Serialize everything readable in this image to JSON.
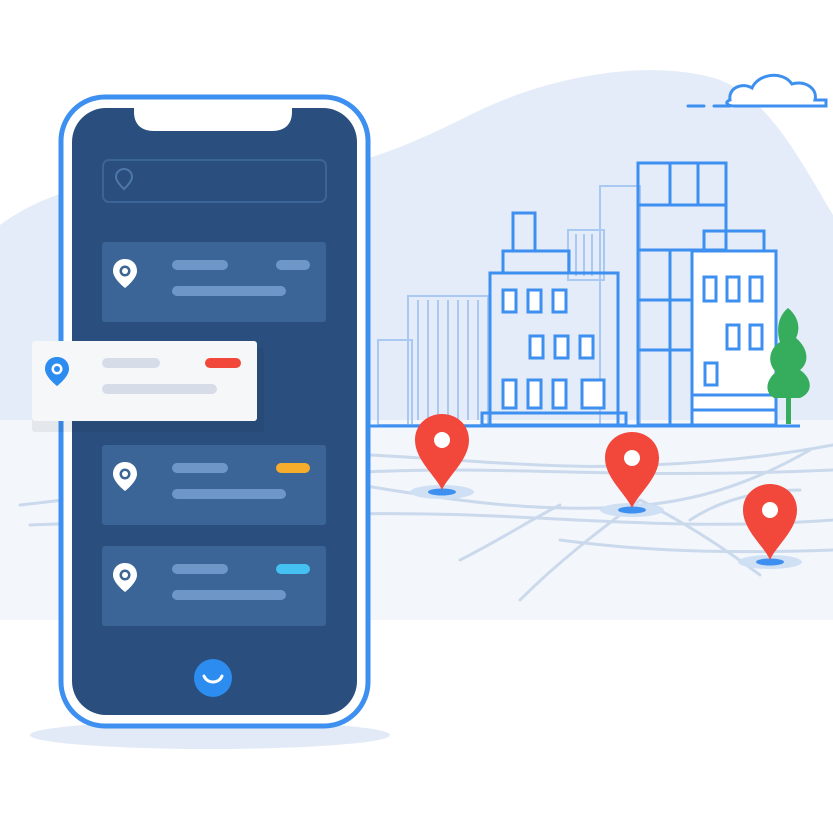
{
  "colors": {
    "background": "#ffffff",
    "blob": "#e3ecf8",
    "road": "#cbd9ec",
    "outline": "#3d8ff0",
    "outline_light": "#a9c9f2",
    "phone_frame": "#3d8ff0",
    "phone_screen": "#2a4f7e",
    "card": "#3b6596",
    "card_bar": "#6e97c8",
    "popup_bg": "#f6f7f9",
    "popup_bar": "#d6dde8",
    "pin_red": "#f2473b",
    "tree_green": "#36ad5c",
    "home_button": "#2d8cf0",
    "tag_red": "#f2473b",
    "tag_orange": "#f6ad2c",
    "tag_cyan": "#44c1f0"
  },
  "phone": {
    "search_icon": "location-pin-outline-icon",
    "home_icon": "smile-icon",
    "cards": [
      {
        "icon": "location-pin-icon",
        "tag_color": "none"
      },
      {
        "icon": "location-pin-icon",
        "tag_color": "orange"
      },
      {
        "icon": "location-pin-icon",
        "tag_color": "cyan"
      }
    ],
    "popup_card": {
      "icon": "location-pin-icon",
      "tag_color": "red"
    }
  },
  "map": {
    "pins": [
      "map-pin-icon",
      "map-pin-icon",
      "map-pin-icon"
    ],
    "decor": [
      "cloud-icon",
      "tree-icon",
      "city-buildings"
    ]
  }
}
